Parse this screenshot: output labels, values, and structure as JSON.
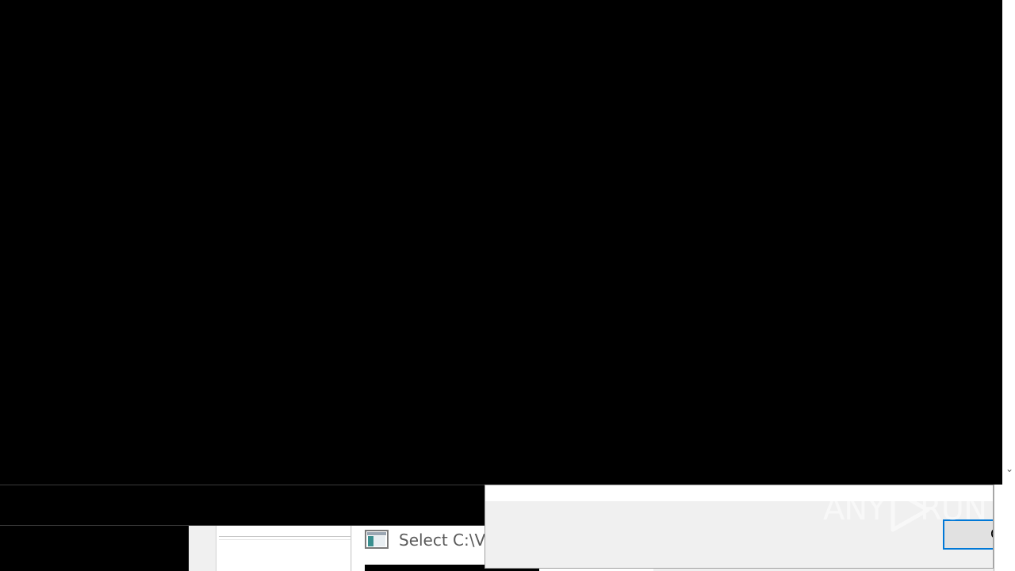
{
  "taskbar": {
    "window_title": "Select C:\\V",
    "window_icon": "console-window-icon"
  },
  "dialog": {
    "button_label": "O"
  },
  "scrollbar": {
    "down_arrow_icon": "chevron-down-icon"
  },
  "watermark": {
    "left": "ANY",
    "right": "RUN",
    "play_icon": "play-triangle-icon"
  },
  "colors": {
    "console_bg": "#000000",
    "dialog_bg": "#f0f0f0",
    "focus_accent": "#0078d7",
    "title_text": "#5a5a5a"
  }
}
